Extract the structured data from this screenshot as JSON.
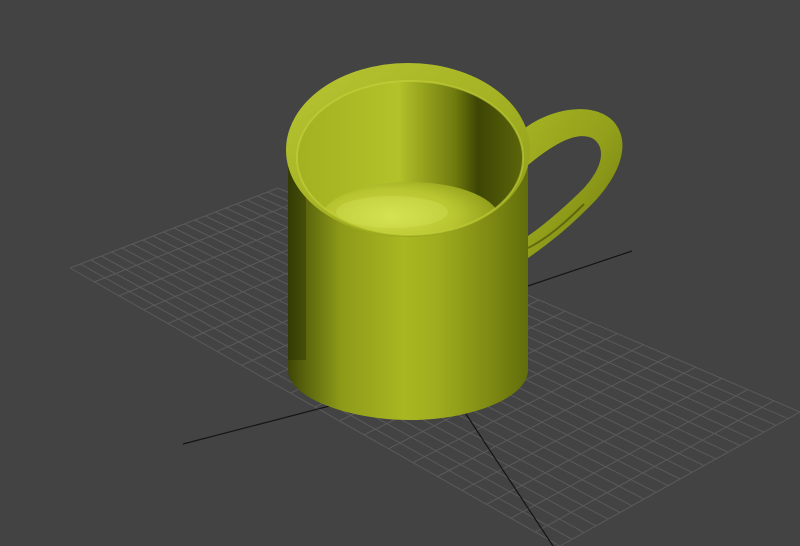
{
  "viewport": {
    "background_color": "#434343",
    "grid_color": "#5a5a5a",
    "axis_color": "#151515",
    "object": {
      "type": "mug",
      "color": "#9aa81a",
      "highlight_color": "#c4d23a",
      "shadow_color": "#3a4205"
    }
  }
}
